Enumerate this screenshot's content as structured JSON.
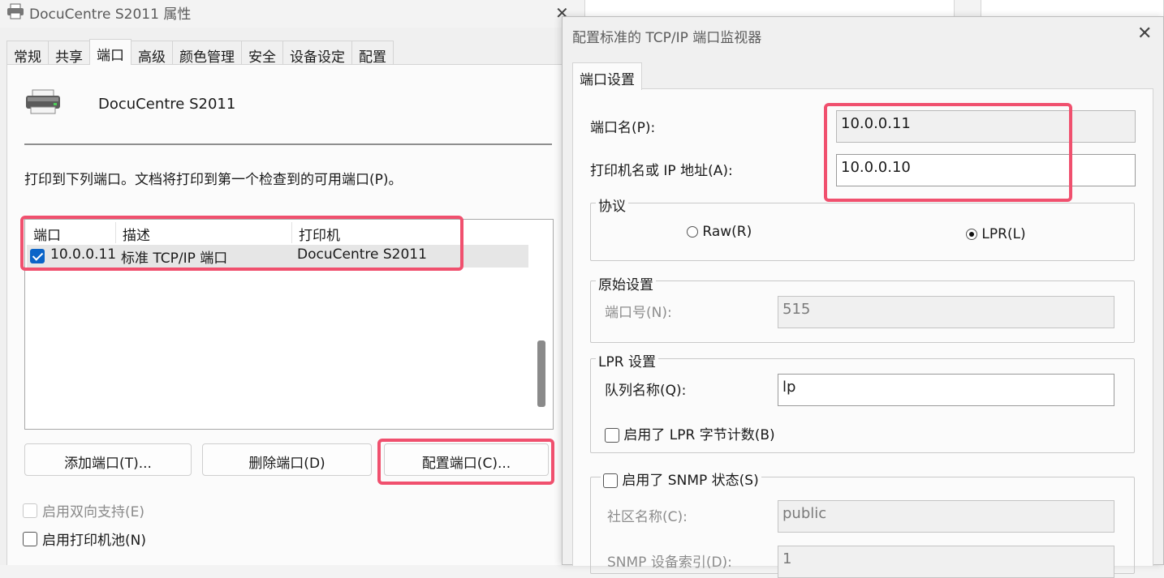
{
  "props_window": {
    "title": "DocuCentre S2011 属性",
    "tabs": [
      "常规",
      "共享",
      "端口",
      "高级",
      "颜色管理",
      "安全",
      "设备设定",
      "配置"
    ],
    "active_tab": "端口",
    "printer_name": "DocuCentre S2011",
    "instruction": "打印到下列端口。文档将打印到第一个检查到的可用端口(P)。",
    "list_headers": [
      "端口",
      "描述",
      "打印机"
    ],
    "list_rows": [
      {
        "checked": true,
        "port": "10.0.0.11",
        "description": "标准 TCP/IP 端口",
        "printer": "DocuCentre S2011"
      }
    ],
    "buttons": {
      "add": "添加端口(T)...",
      "delete": "删除端口(D)",
      "configure": "配置端口(C)..."
    },
    "options": {
      "bidirectional": "启用双向支持(E)",
      "pooling": "启用打印机池(N)"
    }
  },
  "tcpip_dialog": {
    "title": "配置标准的 TCP/IP 端口监视器",
    "tab": "端口设置",
    "port_name_label": "端口名(P):",
    "port_name_value": "10.0.0.11",
    "host_label": "打印机名或 IP 地址(A):",
    "host_value": "10.0.0.10",
    "protocol": {
      "legend": "协议",
      "raw_label": "Raw(R)",
      "lpr_label": "LPR(L)",
      "selected": "LPR"
    },
    "raw_settings": {
      "legend": "原始设置",
      "port_number_label": "端口号(N):",
      "port_number_value": "515"
    },
    "lpr_settings": {
      "legend": "LPR 设置",
      "queue_label": "队列名称(Q):",
      "queue_value": "lp",
      "byte_count_label": "启用了 LPR 字节计数(B)"
    },
    "snmp": {
      "legend": "启用了 SNMP 状态(S)",
      "community_label": "社区名称(C):",
      "community_value": "public",
      "device_index_label": "SNMP 设备索引(D):",
      "device_index_value": "1"
    }
  },
  "highlight_color": "#f0506e"
}
